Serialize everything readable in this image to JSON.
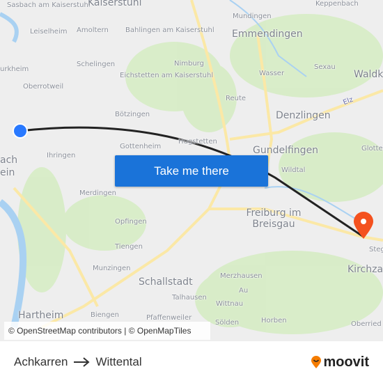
{
  "map": {
    "labels": [
      "Sasbach am Kaiserstuhl",
      "Kaiserstuhl",
      "Leiselheim",
      "Amoltern",
      "Bahlingen am Kaiserstuhl",
      "urkheim",
      "Schelingen",
      "Eichstetten am Kaiserstuhl",
      "Oberrotweil",
      "Nimburg",
      "Bötzingen",
      "Gottenheim",
      "Ihringen",
      "ach",
      "ein",
      "Mundingen",
      "Keppenbach",
      "Emmendingen",
      "Wasser",
      "Sexau",
      "Waldk",
      "Reute",
      "Elz",
      "Denzlingen",
      "Gundelfingen",
      "Glotter",
      "Hugstetten",
      "Wildtal",
      "Merdingen",
      "Opfingen",
      "Tiengen",
      "Munzingen",
      "Schallstadt",
      "Talhausen",
      "Hartheim",
      "Biengen",
      "Pfaffenweiler",
      "Freiburg im Breisgau",
      "Merzhausen",
      "Au",
      "Wittnau",
      "Sölden",
      "Horben",
      "Kirchzar",
      "Steg",
      "Oberried"
    ],
    "attribution": "© OpenStreetMap contributors | © OpenMapTiles",
    "origin_color": "#2979ff",
    "destination_color": "#f4511e",
    "route_color": "#222222"
  },
  "cta": {
    "label": "Take me there"
  },
  "footer": {
    "from": "Achkarren",
    "arrow_icon": "arrow-right-icon",
    "to": "Wittental",
    "brand": "moovit",
    "brand_color": "#f57c00"
  }
}
